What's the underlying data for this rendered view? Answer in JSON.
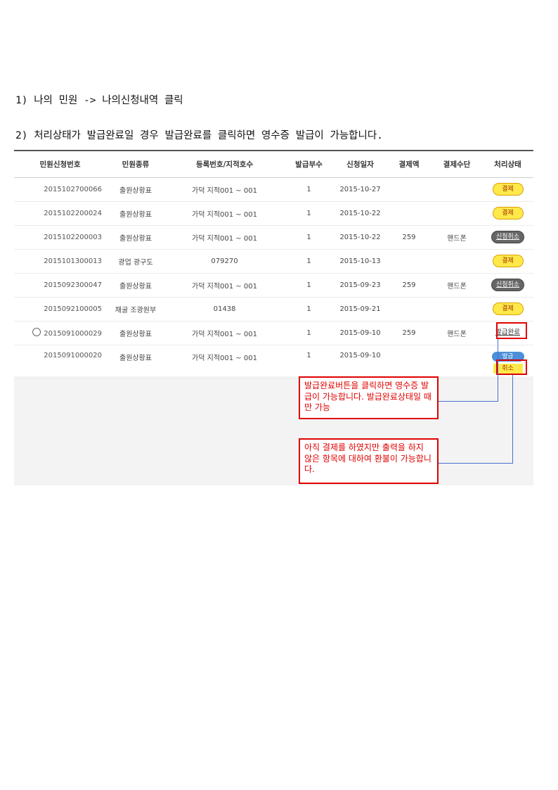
{
  "step1": "1) 나의 민원 -> 나의신청내역 클릭",
  "step2": "2) 처리상태가 발급완료일 경우 발급완료를 클릭하면 영수증 발급이 가능합니다.",
  "table": {
    "headers": [
      "민원신청번호",
      "민원종류",
      "등록번호/지적호수",
      "발급부수",
      "신청일자",
      "결제액",
      "결제수단",
      "처리상태"
    ],
    "rows": [
      {
        "no": "2015102700066",
        "type": "출원상황표",
        "reg": "가덕 지적001 ~ 001",
        "copies": "1",
        "date": "2015-10-27",
        "amount": "",
        "method": "",
        "status": "결제"
      },
      {
        "no": "2015102200024",
        "type": "출원상황표",
        "reg": "가덕 지적001 ~ 001",
        "copies": "1",
        "date": "2015-10-22",
        "amount": "",
        "method": "",
        "status": "결제"
      },
      {
        "no": "2015102200003",
        "type": "출원상황표",
        "reg": "가덕 지적001 ~ 001",
        "copies": "1",
        "date": "2015-10-22",
        "amount": "259",
        "method": "핸드폰",
        "status": "신청취소"
      },
      {
        "no": "2015101300013",
        "type": "광업 광구도",
        "reg": "079270",
        "copies": "1",
        "date": "2015-10-13",
        "amount": "",
        "method": "",
        "status": "결제"
      },
      {
        "no": "2015092300047",
        "type": "출원상황표",
        "reg": "가덕 지적001 ~ 001",
        "copies": "1",
        "date": "2015-09-23",
        "amount": "259",
        "method": "핸드폰",
        "status": "신청취소"
      },
      {
        "no": "2015092100005",
        "type": "채굴 조광원부",
        "reg": "01438",
        "copies": "1",
        "date": "2015-09-21",
        "amount": "",
        "method": "",
        "status": "결제"
      },
      {
        "no": "2015091000029",
        "type": "출원상황표",
        "reg": "가덕 지적001 ~ 001",
        "copies": "1",
        "date": "2015-09-10",
        "amount": "259",
        "method": "핸드폰",
        "status": "발급완료"
      },
      {
        "no": "2015091000020",
        "type": "출원상황표",
        "reg": "가덕 지적001 ~ 001",
        "copies": "1",
        "date": "2015-09-10",
        "amount": "",
        "method": "",
        "status": "발급",
        "status2": "취소"
      }
    ]
  },
  "note1": "발급완료버튼을 클릭하면 영수증 발급이 가능합니다. 발급완료상태일 때만 가능",
  "note2": "아직 결제를 하였지만 출력을 하지 않은 항목에 대하여 환불이 가능합니다.",
  "colors": {
    "highlight": "#e00000",
    "connector": "#4a6fd0",
    "pay_badge": "#ffe94a",
    "cancel_badge": "#666666"
  }
}
